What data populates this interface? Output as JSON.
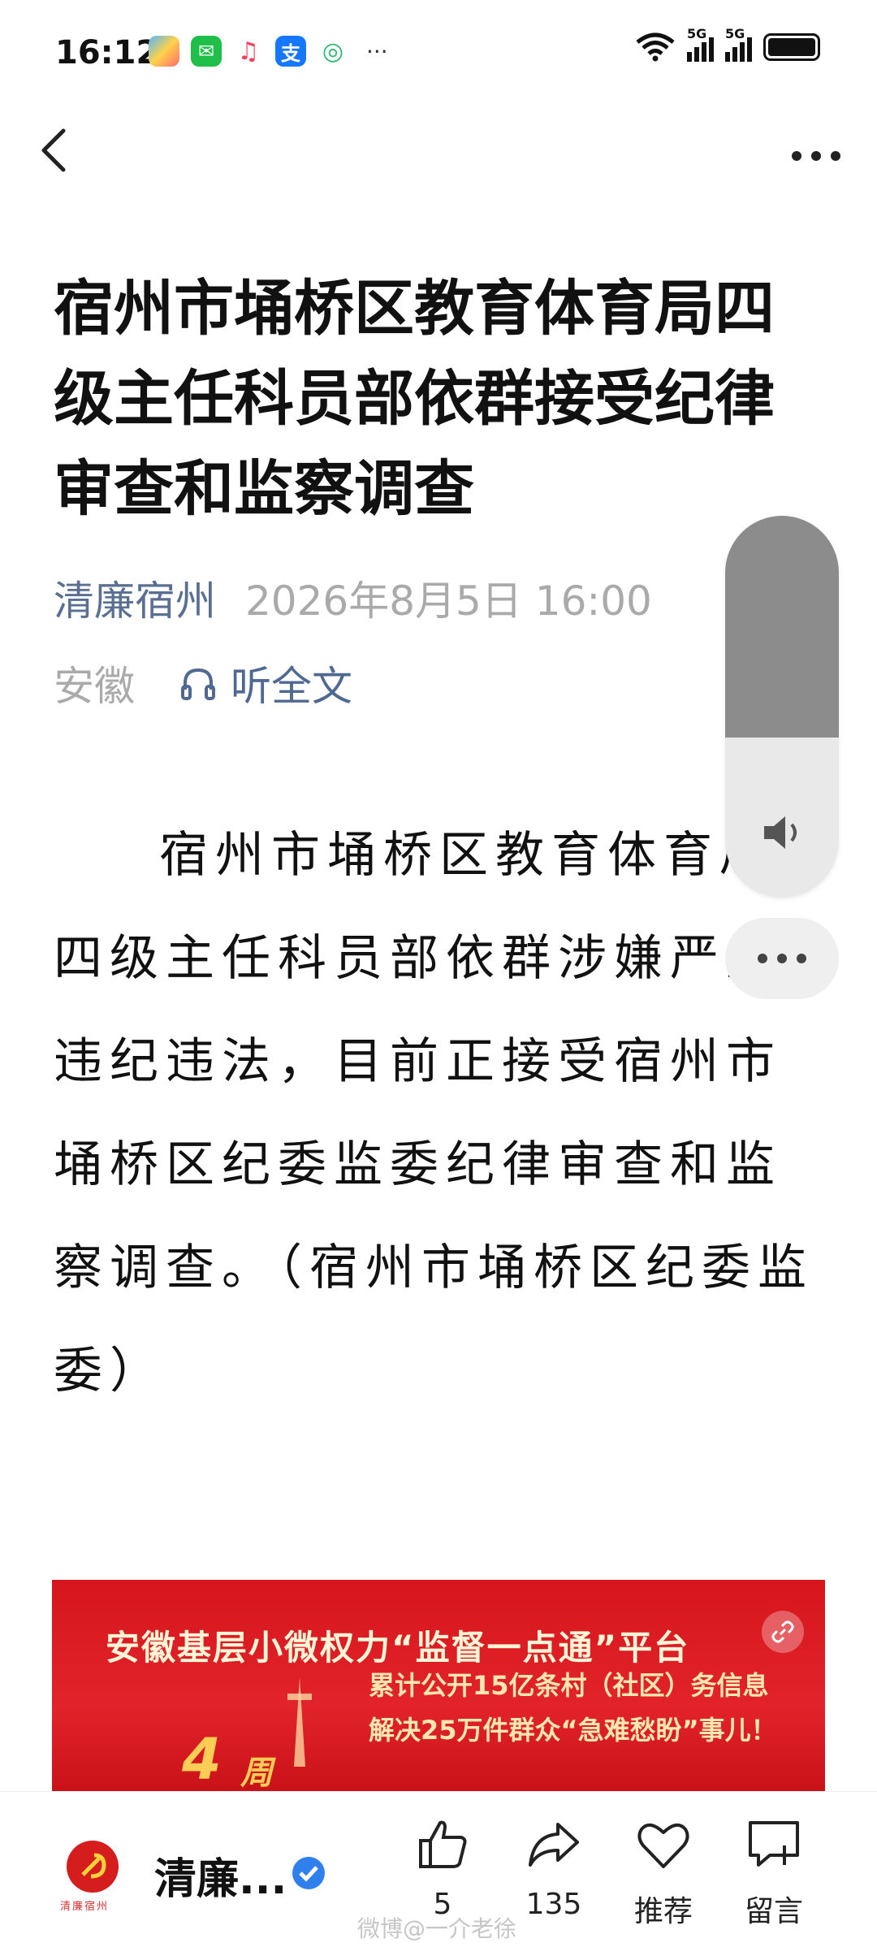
{
  "status_bar": {
    "time": "16:12",
    "network_1": "5G",
    "network_2": "5G",
    "more_label": "···"
  },
  "nav": {
    "back_icon": "chevron-left-icon",
    "more_icon": "more-horizontal-icon"
  },
  "article": {
    "title": "宿州市埇桥区教育体育局四级主任科员部依群接受纪律审查和监察调查",
    "source": "清廉宿州",
    "date": "2026年8月5日 16:00",
    "region": "安徽",
    "listen_label": "听全文",
    "body": "宿州市埇桥区教育体育局四级主任科员部依群涉嫌严重违纪违法，目前正接受宿州市埇桥区纪委监委纪律审查和监察调查。（宿州市埇桥区纪委监委）"
  },
  "floating": {
    "volume_level": 0.58
  },
  "banner": {
    "headline": "安徽基层小微权力“监督一点通”平台",
    "badge_number": "4",
    "badge_week": "周",
    "line1": "累计公开15亿条村（社区）务信息",
    "line2": "解决25万件群众“急难愁盼”事儿！"
  },
  "bottom_bar": {
    "account_name": "清廉...",
    "logo_caption": "清廉宿州",
    "like_count": "5",
    "share_count": "135",
    "recommend_label": "推荐",
    "comment_label": "留言"
  },
  "watermark": "微博@一介老徐",
  "colors": {
    "source_blue": "#5a6f91",
    "listen_blue": "#4f6993",
    "banner_red": "#d6161c",
    "verified_blue": "#2f80ed"
  }
}
